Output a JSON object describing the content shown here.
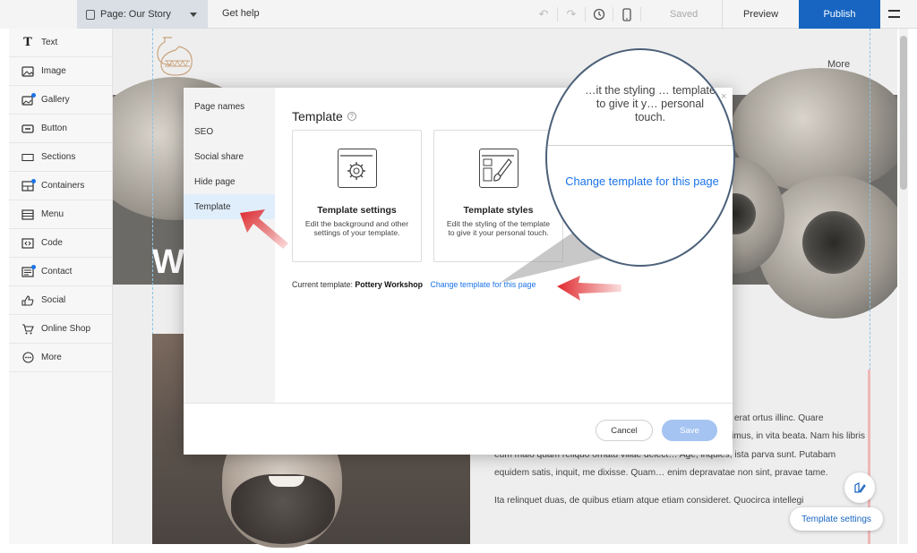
{
  "topbar": {
    "page_label": "Page: Our Story",
    "get_help": "Get help",
    "saved": "Saved",
    "preview": "Preview",
    "publish": "Publish"
  },
  "sidebar": {
    "items": [
      {
        "label": "Text",
        "icon": "text-icon"
      },
      {
        "label": "Image",
        "icon": "image-icon"
      },
      {
        "label": "Gallery",
        "icon": "gallery-icon"
      },
      {
        "label": "Button",
        "icon": "button-icon"
      },
      {
        "label": "Sections",
        "icon": "sections-icon"
      },
      {
        "label": "Containers",
        "icon": "containers-icon"
      },
      {
        "label": "Menu",
        "icon": "menu-icon"
      },
      {
        "label": "Code",
        "icon": "code-icon"
      },
      {
        "label": "Contact",
        "icon": "contact-icon"
      },
      {
        "label": "Social",
        "icon": "social-icon"
      },
      {
        "label": "Online Shop",
        "icon": "cart-icon"
      },
      {
        "label": "More",
        "icon": "more-icon"
      }
    ]
  },
  "site": {
    "more": "More",
    "hero_letter": "W",
    "paragraph1": "…tudinum instituendarum …ia non sequebatur, idcirco non erat ortus illinc. Quare obscurentur etiam haec, quae secundum naturam esse dicimus, in vita beata. Nam his libris eum malo quam reliquo ornatu villae delect… Age, inquies, ista parva sunt. Putabam equidem satis, inquit, me dixisse. Quam… enim depravatae non sint, pravae tame.",
    "paragraph2": "Ita relinquet duas, de quibus etiam atque etiam consideret. Quocirca intellegi",
    "template_settings_pill": "Template settings"
  },
  "modal": {
    "nav": [
      "Page names",
      "SEO",
      "Social share",
      "Hide page",
      "Template"
    ],
    "active_nav": "Template",
    "title": "Template",
    "help_glyph": "?",
    "card1": {
      "title": "Template settings",
      "desc": "Edit the background and other settings of your template."
    },
    "card2": {
      "title": "Template styles",
      "desc": "Edit the styling of the template to give it your personal touch."
    },
    "current_label": "Current template:",
    "current_value": "Pottery Workshop",
    "change_link": "Change template for this page",
    "cancel": "Cancel",
    "save": "Save",
    "close": "×"
  },
  "magnifier": {
    "partial_text": "…it the styling … template to give it y… personal touch.",
    "link": "Change template for this page"
  },
  "colors": {
    "accent": "#1765c1",
    "link": "#1a73e8",
    "arrow": "#d9252b",
    "save_disabled": "#a5c4f2"
  }
}
